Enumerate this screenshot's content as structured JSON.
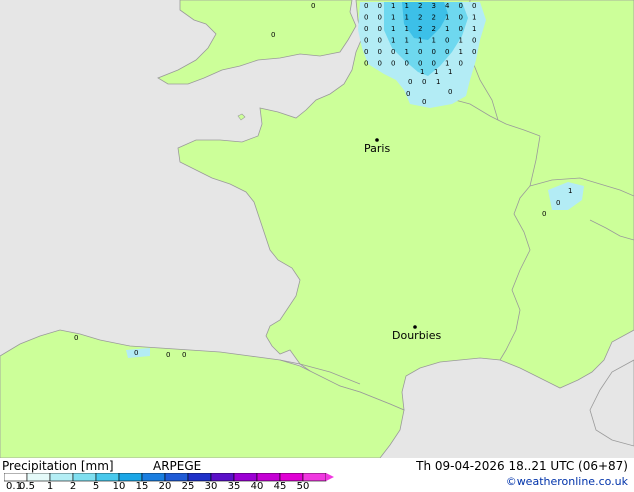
{
  "map": {
    "cities": [
      {
        "name": "Paris"
      },
      {
        "name": "Dourbies"
      }
    ],
    "precip_values": {
      "belgium_grid": [
        [
          "0",
          "0",
          "1",
          "1",
          "2",
          "3",
          "4",
          "0",
          "0"
        ],
        [
          "0",
          "0",
          "1",
          "1",
          "2",
          "2",
          "1",
          "0",
          "1"
        ],
        [
          "0",
          "0",
          "1",
          "1",
          "2",
          "2",
          "1",
          "0",
          "1"
        ],
        [
          "0",
          "0",
          "1",
          "1",
          "1",
          "1",
          "0",
          "1",
          "0"
        ],
        [
          "0",
          "0",
          "0",
          "1",
          "0",
          "0",
          "0",
          "1",
          "0"
        ],
        [
          "0",
          "0",
          "0",
          "0",
          "0",
          "0",
          "1",
          "0"
        ]
      ],
      "lux_cells": [
        "1",
        "1",
        "1",
        "0",
        "0",
        "1",
        "0",
        "0",
        "0"
      ],
      "swiss_cells": [
        "1",
        "0",
        "0"
      ],
      "uk_cells": [
        "0",
        "0"
      ],
      "spain_cells": [
        "0",
        "0",
        "0",
        "0"
      ]
    },
    "colors": {
      "land": "#ccff99",
      "sea": "#e6e6e6",
      "border": "#9a9a9a",
      "precip_light": "#b3ecf5",
      "precip_medium": "#6ed8ef",
      "precip_heavy": "#3cc0e8"
    }
  },
  "footer": {
    "legend_title": "Precipitation [mm]",
    "model": "ARPEGE",
    "valid_time": "Th 09-04-2026 18..21 UTC (06+87)",
    "copyright": "©weatheronline.co.uk",
    "scale_labels": [
      "0.1",
      "0.5",
      "1",
      "2",
      "5",
      "10",
      "15",
      "20",
      "25",
      "30",
      "35",
      "40",
      "45",
      "50"
    ],
    "scale_colors": [
      "#ffffff",
      "#e5faf9",
      "#b4eef5",
      "#7fdff0",
      "#48c8ec",
      "#1aa6e6",
      "#1a7ee0",
      "#1f5bd6",
      "#1e30c8",
      "#5a10c8",
      "#9b00d4",
      "#c400d4",
      "#e000d4",
      "#f038e0"
    ]
  }
}
